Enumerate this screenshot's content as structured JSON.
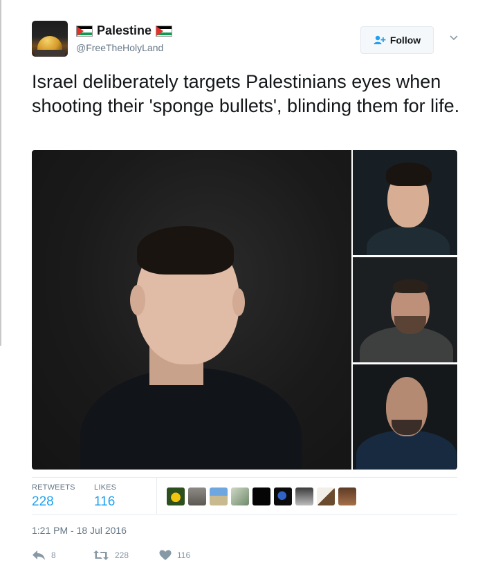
{
  "tweet": {
    "display_name": "Palestine",
    "handle": "@FreeTheHolyLand",
    "follow_label": "Follow",
    "text": "Israel deliberately targets Palestinians eyes when shooting their 'sponge bullets', blinding them for life.",
    "timestamp": "1:21 PM - 18 Jul 2016"
  },
  "stats": {
    "retweets_label": "RETWEETS",
    "retweets": "228",
    "likes_label": "LIKES",
    "likes": "116"
  },
  "actions": {
    "reply_count": "8",
    "retweet_count": "228",
    "like_count": "116"
  },
  "icons": {
    "follow": "add-user-icon",
    "more": "chevron-down-icon",
    "reply": "reply-icon",
    "retweet": "retweet-icon",
    "like": "heart-icon"
  },
  "colors": {
    "accent": "#1da1f2",
    "text": "#14171a",
    "muted": "#657786",
    "icon": "#8899a6",
    "flag_red": "#e4312b",
    "flag_green": "#149954"
  }
}
